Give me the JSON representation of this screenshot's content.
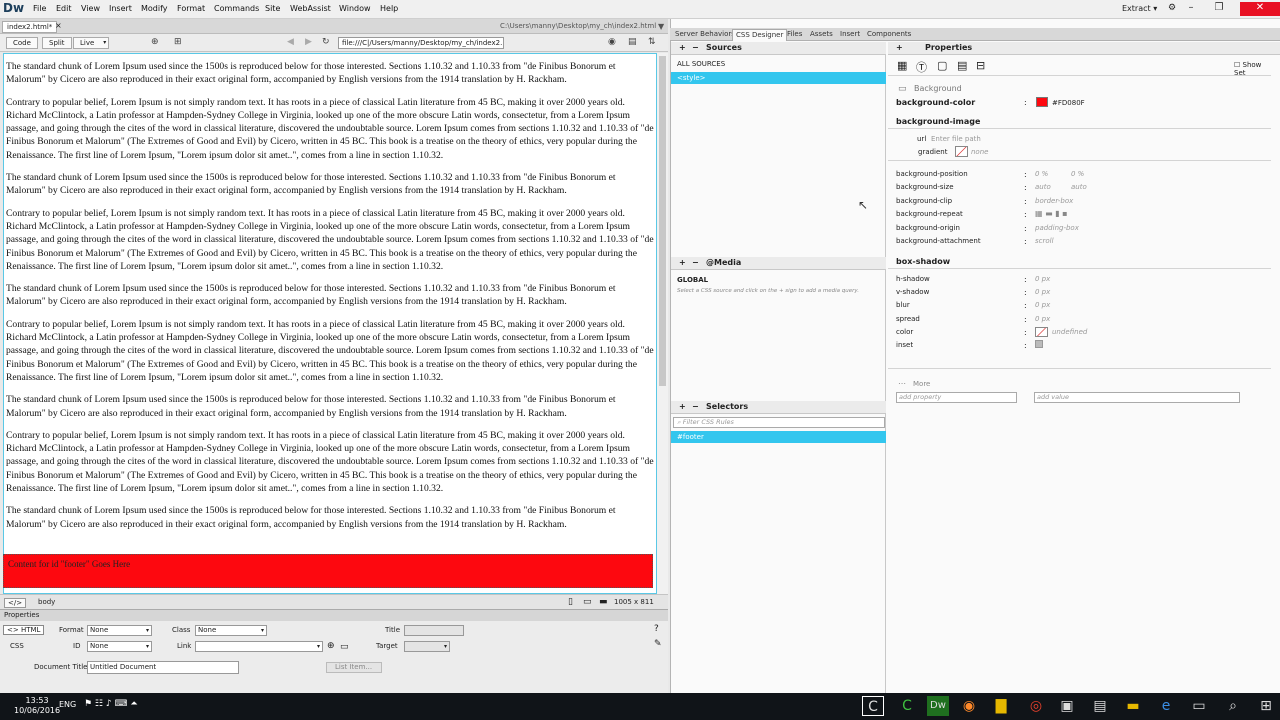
{
  "app": {
    "logo": "Dw",
    "workspace": "Extract"
  },
  "menu": [
    "File",
    "Edit",
    "View",
    "Insert",
    "Modify",
    "Format",
    "Commands",
    "Site",
    "WebAssist",
    "Window",
    "Help"
  ],
  "document": {
    "tab": "index2.html*",
    "close": "×",
    "path": "C:\\Users\\manny\\Desktop\\my_ch\\index2.html"
  },
  "toolbar": {
    "code": "Code",
    "split": "Split",
    "live": "Live",
    "url": "file:///C|/Users/manny/Desktop/my_ch/index2..."
  },
  "content": {
    "standard": "The standard chunk of Lorem Ipsum used since the 1500s is reproduced below for those interested. Sections 1.10.32 and 1.10.33 from \"de Finibus Bonorum et Malorum\" by Cicero are also reproduced in their exact original form, accompanied by English versions from the 1914 translation by H. Rackham.",
    "contrary": "Contrary to popular belief, Lorem Ipsum is not simply random text. It has roots in a piece of classical Latin literature from 45 BC, making it over 2000 years old. Richard McClintock, a Latin professor at Hampden-Sydney College in Virginia, looked up one of the more obscure Latin words, consectetur, from a Lorem Ipsum passage, and going through the cites of the word in classical literature, discovered the undoubtable source. Lorem Ipsum comes from sections 1.10.32 and 1.10.33 of \"de Finibus Bonorum et Malorum\" (The Extremes of Good and Evil) by Cicero, written in 45 BC. This book is a treatise on the theory of ethics, very popular during the Renaissance. The first line of Lorem Ipsum, \"Lorem ipsum dolor sit amet..\", comes from a line in section 1.10.32.",
    "footer": "Content for id \"footer\" Goes Here"
  },
  "statusbar": {
    "tag_selector": "</>",
    "body": "body",
    "size": "1005 x 811"
  },
  "properties_panel": {
    "title": "Properties",
    "html": "HTML",
    "css": "CSS",
    "format_label": "Format",
    "format_value": "None",
    "class_label": "Class",
    "class_value": "None",
    "id_label": "ID",
    "id_value": "None",
    "link_label": "Link",
    "title_label": "Title",
    "target_label": "Target",
    "doc_title_label": "Document Title",
    "doc_title_value": "Untitled Document",
    "list_item": "List Item..."
  },
  "right_tabs": [
    "Server Behaviors",
    "CSS Designer",
    "Files",
    "Assets",
    "Insert",
    "Components"
  ],
  "css_designer": {
    "sources_title": "Sources",
    "all_sources": "ALL SOURCES",
    "style": "<style>",
    "media_title": "@Media",
    "global": "GLOBAL",
    "media_hint": "Select a CSS source and click on the + sign to add a media query.",
    "selectors_title": "Selectors",
    "filter_placeholder": "Filter CSS Rules",
    "selector": "#footer",
    "properties_title": "Properties",
    "show_set": "Show Set",
    "background_section": "Background",
    "bg_color_label": "background-color",
    "bg_color_value": "#FD080F",
    "bg_image_label": "background-image",
    "url_label": "url",
    "url_placeholder": "Enter file path",
    "gradient_label": "gradient",
    "gradient_value": "none",
    "rows": [
      {
        "label": "background-position",
        "v1": "0 %",
        "v2": "0 %"
      },
      {
        "label": "background-size",
        "v1": "auto",
        "v2": "auto"
      },
      {
        "label": "background-clip",
        "v1": "border-box",
        "v2": ""
      },
      {
        "label": "background-repeat",
        "v1": "",
        "v2": ""
      },
      {
        "label": "background-origin",
        "v1": "padding-box",
        "v2": ""
      },
      {
        "label": "background-attachment",
        "v1": "scroll",
        "v2": ""
      }
    ],
    "box_shadow_label": "box-shadow",
    "shadow_rows": [
      {
        "label": "h-shadow",
        "v": "0 px"
      },
      {
        "label": "v-shadow",
        "v": "0 px"
      },
      {
        "label": "blur",
        "v": "0 px"
      },
      {
        "label": "spread",
        "v": "0 px"
      },
      {
        "label": "color",
        "v": "undefined"
      },
      {
        "label": "inset",
        "v": ""
      }
    ],
    "more_label": "More",
    "add_property": "add property",
    "add_value": "add value",
    "accent": "#33c6ee",
    "footer_color": "#FD080F"
  },
  "taskbar": {
    "time": "13:53",
    "date": "10/06/2016",
    "lang": "ENG"
  }
}
